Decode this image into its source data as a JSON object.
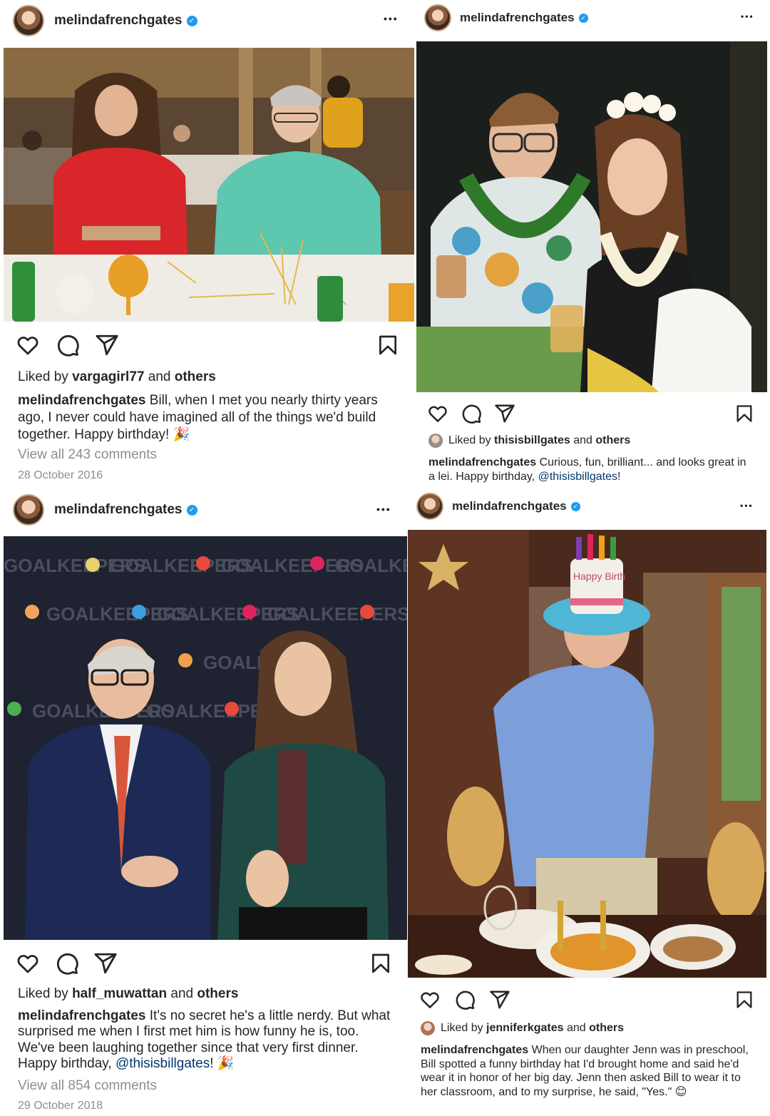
{
  "posts": [
    {
      "username": "melindafrenchgates",
      "verified_glyph": "✓",
      "more_label": "•••",
      "liked_prefix": "Liked by",
      "liked_user": "vargagirl77",
      "liked_and": "and",
      "liked_others": "others",
      "caption_user": "melindafrenchgates",
      "caption_text": "Bill, when I met you nearly thirty years ago, I never could have imagined all of the things we'd build together. Happy birthday!",
      "caption_emoji": "🎉",
      "comments": "View all 243 comments",
      "date": "28 October 2016"
    },
    {
      "username": "melindafrenchgates",
      "verified_glyph": "✓",
      "more_label": "•••",
      "liked_prefix": "Liked by",
      "liked_user": "thisisbillgates",
      "liked_and": "and",
      "liked_others": "others",
      "caption_user": "melindafrenchgates",
      "caption_text": "Curious, fun, brilliant... and looks great in a lei. Happy birthday,",
      "caption_mention": "@thisisbillgates",
      "caption_after": "!"
    },
    {
      "username": "melindafrenchgates",
      "verified_glyph": "✓",
      "more_label": "•••",
      "liked_prefix": "Liked by",
      "liked_user": "half_muwattan",
      "liked_and": "and",
      "liked_others": "others",
      "caption_user": "melindafrenchgates",
      "caption_text": "It's no secret he's a little nerdy. But what surprised me when I first met him is how funny he is, too. We've been laughing together since that very first dinner. Happy birthday,",
      "caption_mention": "@thisisbillgates",
      "caption_after": "!",
      "caption_emoji": "🎉",
      "comments": "View all 854 comments",
      "date": "29 October 2018"
    },
    {
      "username": "melindafrenchgates",
      "verified_glyph": "✓",
      "more_label": "•••",
      "liked_prefix": "Liked by",
      "liked_user": "jenniferkgates",
      "liked_and": "and",
      "liked_others": "others",
      "caption_user": "melindafrenchgates",
      "caption_text": "When our daughter Jenn was in preschool, Bill spotted a funny birthday hat I'd brought home and said he'd wear it in honor of her big day. Jenn then asked Bill to wear it to her classroom, and to my surprise, he said, \"Yes.\"",
      "caption_emoji": "😊"
    }
  ],
  "photo4_hat_text": "Happy Birth",
  "photo3_backdrop_text": "GOALKEEPERS",
  "colors": {
    "verified": "#1d9bf0",
    "mention": "#00376b",
    "muted": "#8e8e8e",
    "text": "#262626"
  },
  "icons": [
    "heart-icon",
    "comment-icon",
    "share-icon",
    "bookmark-icon",
    "verified-badge-icon",
    "more-icon"
  ]
}
